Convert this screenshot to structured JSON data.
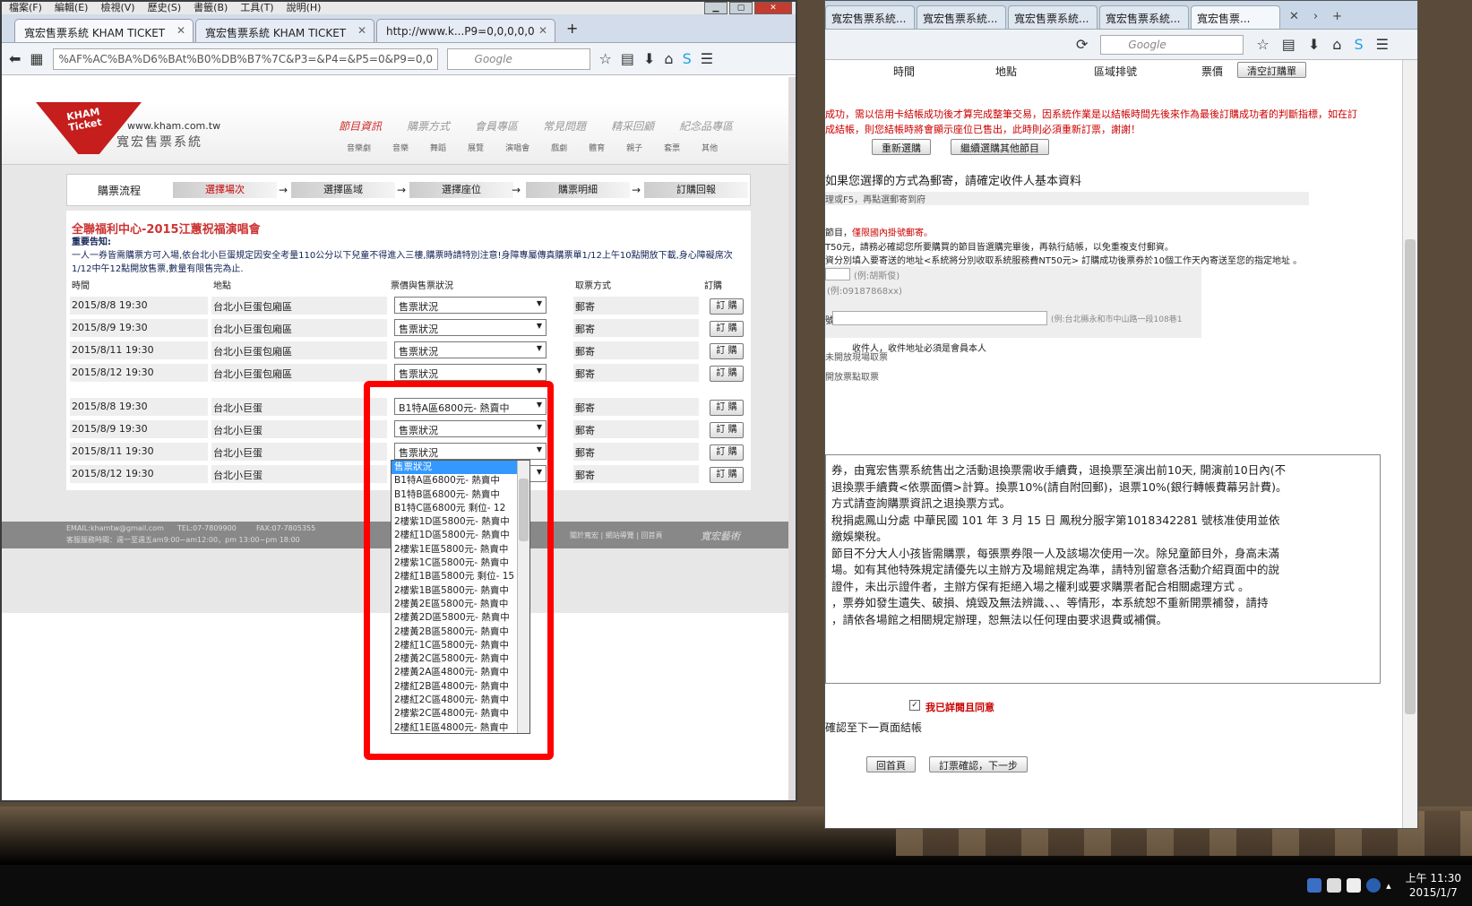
{
  "left_window": {
    "menu": [
      "檔案(F)",
      "編輯(E)",
      "檢視(V)",
      "歷史(S)",
      "書籤(B)",
      "工具(T)",
      "說明(H)"
    ],
    "tabs": [
      {
        "label": "寬宏售票系統 KHAM TICKET"
      },
      {
        "label": "寬宏售票系統 KHAM TICKET"
      },
      {
        "label": "http://www.k...P9=0,0,0,0,0"
      }
    ],
    "url": "%AF%AC%BA%D6%BAt%B0%DB%B7%7C&P3=&P4=&P5=0&P9=0,0",
    "search_placeholder": "Google",
    "site": {
      "logo": "KHAM Ticket",
      "domain": "www.kham.com.tw",
      "name": "寬宏售票系統"
    },
    "topnav": [
      "節目資訊",
      "購票方式",
      "會員專區",
      "常見問題",
      "精采回顧",
      "紀念品專區"
    ],
    "subnav": [
      "音樂劇",
      "音樂",
      "舞蹈",
      "展覽",
      "演唱會",
      "戲劇",
      "體育",
      "親子",
      "套票",
      "其他"
    ],
    "steps": {
      "title": "購票流程",
      "items": [
        "選擇場次",
        "選擇區域",
        "選擇座位",
        "購票明細",
        "訂購回報"
      ]
    },
    "event_title": "全聯福利中心-2015江蕙祝福演唱會",
    "notice_label": "重要告知:",
    "notice": "一人一券皆需購票方可入場,依台北小巨蛋規定因安全考量110公分以下兒童不得進入三樓,購票時請特別注意!身障專屬傳真購票單1/12上午10點開放下載,身心障礙席次1/12中午12點開放售票,數量有限售完為止.",
    "columns": [
      "時間",
      "地點",
      "票價與售票狀況",
      "取票方式",
      "訂購"
    ],
    "rows_group1": [
      {
        "time": "2015/8/8 19:30",
        "venue": "台北小巨蛋包廂區",
        "status": "售票狀況",
        "pickup": "郵寄",
        "buy": "訂 購"
      },
      {
        "time": "2015/8/9 19:30",
        "venue": "台北小巨蛋包廂區",
        "status": "售票狀況",
        "pickup": "郵寄",
        "buy": "訂 購"
      },
      {
        "time": "2015/8/11 19:30",
        "venue": "台北小巨蛋包廂區",
        "status": "售票狀況",
        "pickup": "郵寄",
        "buy": "訂 購"
      },
      {
        "time": "2015/8/12 19:30",
        "venue": "台北小巨蛋包廂區",
        "status": "售票狀況",
        "pickup": "郵寄",
        "buy": "訂 購"
      }
    ],
    "rows_group2": [
      {
        "time": "2015/8/8 19:30",
        "venue": "台北小巨蛋",
        "status": "B1特A區6800元- 熱賣中",
        "pickup": "郵寄",
        "buy": "訂 購"
      },
      {
        "time": "2015/8/9 19:30",
        "venue": "台北小巨蛋",
        "status": "售票狀況",
        "pickup": "郵寄",
        "buy": "訂 購"
      },
      {
        "time": "2015/8/11 19:30",
        "venue": "台北小巨蛋",
        "status": "售票狀況",
        "pickup": "郵寄",
        "buy": "訂 購"
      },
      {
        "time": "2015/8/12 19:30",
        "venue": "台北小巨蛋",
        "status": "售票狀況",
        "pickup": "郵寄",
        "buy": "訂 購"
      }
    ],
    "footer": {
      "email": "EMAIL:khamtw@gmail.com",
      "tel": "TEL:07-7809900",
      "fax": "FAX:07-7805355",
      "hours": "客服服務時間：週一至週五am9:00~am12:00，pm 13:00~pm 18:00",
      "links": "關於寬宏 | 網站導覽 | 回首頁",
      "brand": "寬宏藝術"
    },
    "dropdown_options": [
      "售票狀況",
      "B1特A區6800元- 熱賣中",
      "B1特B區6800元- 熱賣中",
      "B1特C區6800元 剩位- 12",
      "2樓紫1D區5800元- 熱賣中",
      "2樓紅1D區5800元- 熱賣中",
      "2樓紫1E區5800元- 熱賣中",
      "2樓紫1C區5800元- 熱賣中",
      "2樓紅1B區5800元 剩位- 15",
      "2樓紫1B區5800元- 熱賣中",
      "2樓黃2E區5800元- 熱賣中",
      "2樓黃2D區5800元- 熱賣中",
      "2樓黃2B區5800元- 熱賣中",
      "2樓紅1C區5800元- 熱賣中",
      "2樓黃2C區5800元- 熱賣中",
      "2樓黃2A區4800元- 熱賣中",
      "2樓紅2B區4800元- 熱賣中",
      "2樓紅2C區4800元- 熱賣中",
      "2樓紫2C區4800元- 熱賣中",
      "2樓紅1E區4800元- 熱賣中"
    ]
  },
  "right_window": {
    "tabs": [
      "寬宏售票系統...",
      "寬宏售票系統...",
      "寬宏售票系統...",
      "寬宏售票系統...",
      "寬宏售票系統...",
      "寬宏售票..."
    ],
    "search_placeholder": "Google",
    "cols": [
      "時間",
      "地點",
      "區域排號",
      "票價"
    ],
    "clear_btn": "清空訂購單",
    "red_text1": "成功，需以信用卡結帳成功後才算完成整筆交易，因系統作業是以結帳時間先後來作為最後訂購成功者的判斷指標，如在訂",
    "red_text2": "成結帳，則您結帳時將會顯示座位已售出，此時則必須重新訂票，謝謝！",
    "reselect_btn": "重新選購",
    "continue_btn": "繼續選購其他節目",
    "mail_heading": "如果您選擇的方式為郵寄，請確定收件人基本資料",
    "f5_note": "理或F5，再點選郵寄到府",
    "domestic": "僅限國內掛號郵寄。",
    "domestic_prefix": "節目，",
    "fee_note1": "T50元，請務必確認您所要購買的節目皆選購完畢後，再執行結帳，以免重複支付郵資。",
    "fee_note2": "資分別填入要寄送的地址<系統將分別收取系統服務費NT50元> 訂購成功後票券於10個工作天內寄送至您的指定地址 。",
    "name_hint": "(例:胡斯俊)",
    "phone_hint": "(例:09187868xx)",
    "addr_prefix": "號",
    "addr_hint": "(例:台北縣永和市中山路一段108巷1",
    "recipient_note": "收件人，收件地址必須是會員本人",
    "pickup1": "未開放現場取票",
    "pickup2": "開放票點取票",
    "terms": [
      "券，由寬宏售票系統售出之活動退換票需收手續費，退換票至演出前10天, 開演前10日內(不",
      "退換票手續費<依票面價>計算。換票10%(請自附回郵)，退票10%(銀行轉帳費幕另計費)。",
      "方式請查詢購票資訊之退換票方式。",
      "稅捐處鳳山分處 中華民國 101 年 3 月 15 日 鳳稅分服字第1018342281 號核准使用並依",
      "繳娛樂稅。",
      "節目不分大人小孩皆需購票，每張票券限一人及該場次使用一次。除兒童節目外，身高未滿",
      "場。如有其他特殊規定請優先以主辦方及場館規定為準，請特別留意各活動介紹頁面中的說",
      "",
      "證件，未出示證件者，主辦方保有拒絕入場之權利或要求購票者配合相關處理方式 。",
      "",
      "，票券如發生遺失、破損、燒毀及無法辨識、、、等情形，本系統恕不重新開票補發，請持",
      "",
      "",
      "，請依各場館之相關規定辦理，恕無法以任何理由要求退費或補償。"
    ],
    "agree": "我已詳閱且同意",
    "confirm_note": "確認至下一頁面結帳",
    "home_btn": "回首頁",
    "next_btn": "訂票確認，下一步"
  },
  "taskbar": {
    "time": "上午 11:30",
    "date": "2015/1/7"
  }
}
